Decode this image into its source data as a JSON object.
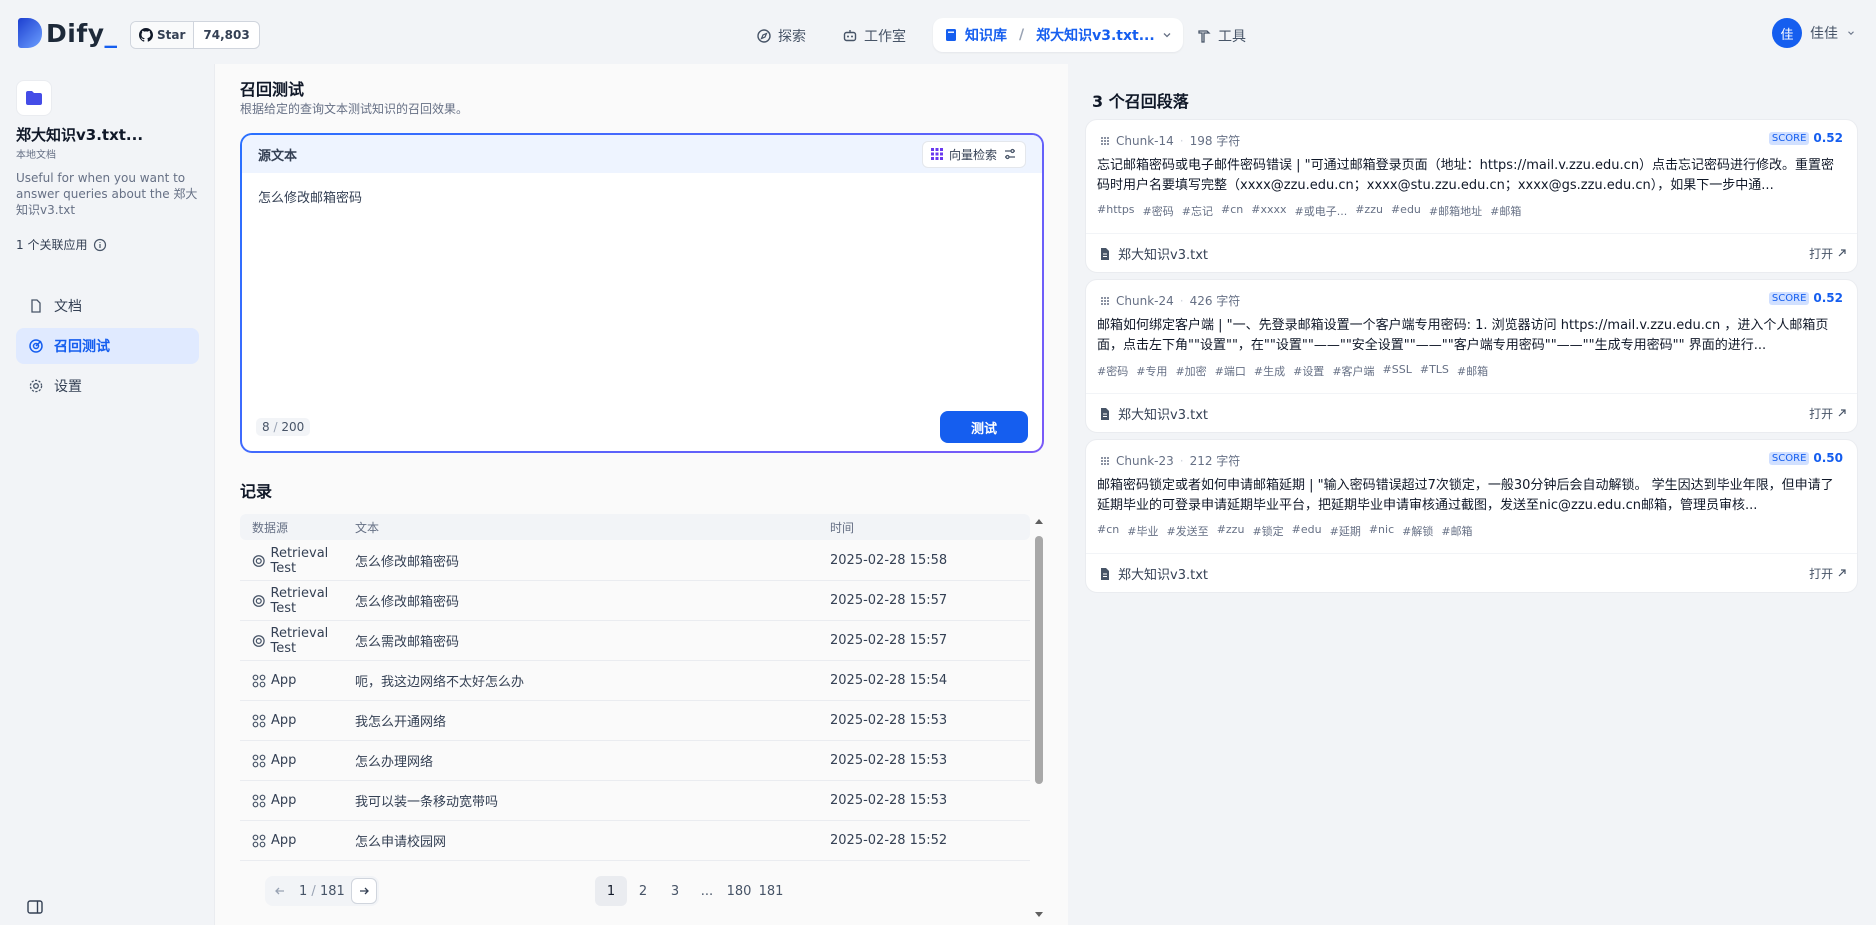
{
  "header": {
    "logo_text": "Dify",
    "logo_cursor": "_",
    "github": {
      "label": "Star",
      "count": "74,803"
    },
    "nav": [
      {
        "label": "探索",
        "icon": "compass-icon"
      },
      {
        "label": "工作室",
        "icon": "robot-icon"
      },
      {
        "label": "知识库",
        "icon": "book-icon"
      },
      {
        "label": "工具",
        "icon": "hammer-icon"
      }
    ],
    "breadcrumb_dataset": "郑大知识v3.txt...",
    "user": {
      "avatar": "佳",
      "name": "佳佳"
    }
  },
  "sidebar": {
    "dataset_title": "郑大知识v3.txt...",
    "dataset_type": "本地文档",
    "description": "Useful for when you want to answer queries about the 郑大知识v3.txt",
    "apps": "1 个关联应用",
    "items": [
      {
        "label": "文档",
        "icon": "document-icon"
      },
      {
        "label": "召回测试",
        "icon": "target-icon"
      },
      {
        "label": "设置",
        "icon": "gear-icon"
      }
    ]
  },
  "main": {
    "title": "召回测试",
    "subtitle": "根据给定的查询文本测试知识的召回效果。",
    "query": {
      "label": "源文本",
      "method": "向量检索",
      "text": "怎么修改邮箱密码",
      "count": "8",
      "max": "200",
      "button": "测试"
    },
    "records_title": "记录",
    "columns": [
      "数据源",
      "文本",
      "时间"
    ],
    "rows": [
      {
        "source": "Retrieval Test",
        "icon": "target-icon",
        "text": "怎么修改邮箱密码",
        "time": "2025-02-28 15:58"
      },
      {
        "source": "Retrieval Test",
        "icon": "target-icon",
        "text": "怎么修改邮箱密码",
        "time": "2025-02-28 15:57"
      },
      {
        "source": "Retrieval Test",
        "icon": "target-icon",
        "text": "怎么需改邮箱密码",
        "time": "2025-02-28 15:57"
      },
      {
        "source": "App",
        "icon": "app-grid-icon",
        "text": "呃，我这边网络不太好怎么办",
        "time": "2025-02-28 15:54"
      },
      {
        "source": "App",
        "icon": "app-grid-icon",
        "text": "我怎么开通网络",
        "time": "2025-02-28 15:53"
      },
      {
        "source": "App",
        "icon": "app-grid-icon",
        "text": "怎么办理网络",
        "time": "2025-02-28 15:53"
      },
      {
        "source": "App",
        "icon": "app-grid-icon",
        "text": "我可以装一条移动宽带吗",
        "time": "2025-02-28 15:53"
      },
      {
        "source": "App",
        "icon": "app-grid-icon",
        "text": "怎么申请校园网",
        "time": "2025-02-28 15:52"
      }
    ],
    "pagination": {
      "current": "1",
      "total": "181",
      "pages": [
        "1",
        "2",
        "3",
        "...",
        "180",
        "181"
      ]
    }
  },
  "results": {
    "title": "3 个召回段落",
    "score_label": "SCORE",
    "open_label": "打开",
    "cards": [
      {
        "chunk": "Chunk-14",
        "chars": "198 字符",
        "score": "0.52",
        "text": "忘记邮箱密码或电子邮件密码错误 | \"可通过邮箱登录页面（地址：https://mail.v.zzu.edu.cn）点击忘记密码进行修改。重置密码时用户名要填写完整（xxxx@zzu.edu.cn；xxxx@stu.zzu.edu.cn；xxxx@gs.zzu.edu.cn），如果下一步中通...",
        "keywords": [
          "https",
          "密码",
          "忘记",
          "cn",
          "xxxx",
          "或电子...",
          "zzu",
          "edu",
          "邮箱地址",
          "邮箱"
        ],
        "doc": "郑大知识v3.txt"
      },
      {
        "chunk": "Chunk-24",
        "chars": "426 字符",
        "score": "0.52",
        "text": "邮箱如何绑定客户端 | \"一、先登录邮箱设置一个客户端专用密码: 1. 浏览器访问 https://mail.v.zzu.edu.cn ，进入个人邮箱页面，点击左下角\"\"设置\"\"，在\"\"设置\"\"——\"\"安全设置\"\"——\"\"客户端专用密码\"\"——\"\"生成专用密码\"\" 界面的进行...",
        "keywords": [
          "密码",
          "专用",
          "加密",
          "端口",
          "生成",
          "设置",
          "客户端",
          "SSL",
          "TLS",
          "邮箱"
        ],
        "doc": "郑大知识v3.txt"
      },
      {
        "chunk": "Chunk-23",
        "chars": "212 字符",
        "score": "0.50",
        "text": "邮箱密码锁定或者如何申请邮箱延期 | \"输入密码错误超过7次锁定，一般30分钟后会自动解锁。 学生因达到毕业年限，但申请了延期毕业的可登录申请延期毕业平台，把延期毕业申请审核通过截图，发送至nic@zzu.edu.cn邮箱，管理员审核...",
        "keywords": [
          "cn",
          "毕业",
          "发送至",
          "zzu",
          "锁定",
          "edu",
          "延期",
          "nic",
          "解锁",
          "邮箱"
        ],
        "doc": "郑大知识v3.txt"
      }
    ]
  },
  "colors": {
    "accent": "#155eef",
    "gradient_end": "#7a5af8"
  }
}
